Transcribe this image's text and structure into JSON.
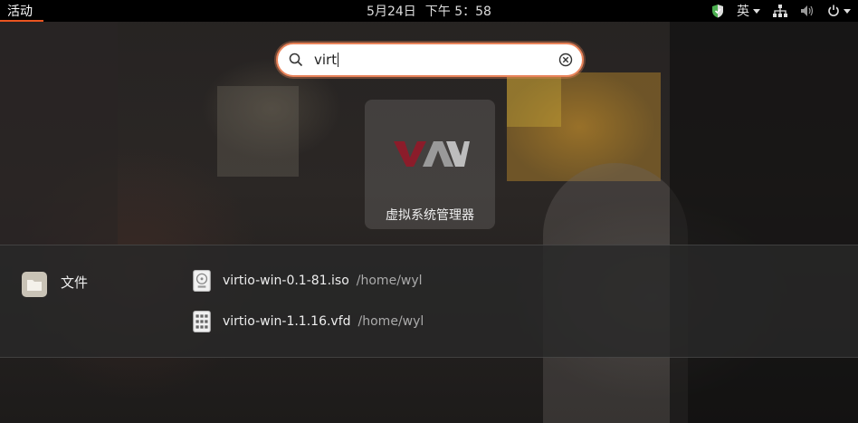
{
  "topbar": {
    "activities": "活动",
    "date": "5月24日",
    "time": "下午 5：58",
    "input_method": "英"
  },
  "search": {
    "query": "virt"
  },
  "apps": [
    {
      "label": "虚拟系统管理器",
      "icon": "virt-manager-logo"
    }
  ],
  "files": {
    "provider_label": "文件",
    "results": [
      {
        "name": "virtio-win-0.1-81.iso",
        "path": "/home/wyl",
        "icon": "disc-image-icon"
      },
      {
        "name": "virtio-win-1.1.16.vfd",
        "path": "/home/wyl",
        "icon": "binary-file-icon"
      }
    ]
  },
  "colors": {
    "accent": "#e95420",
    "search_border": "#e9835a"
  }
}
